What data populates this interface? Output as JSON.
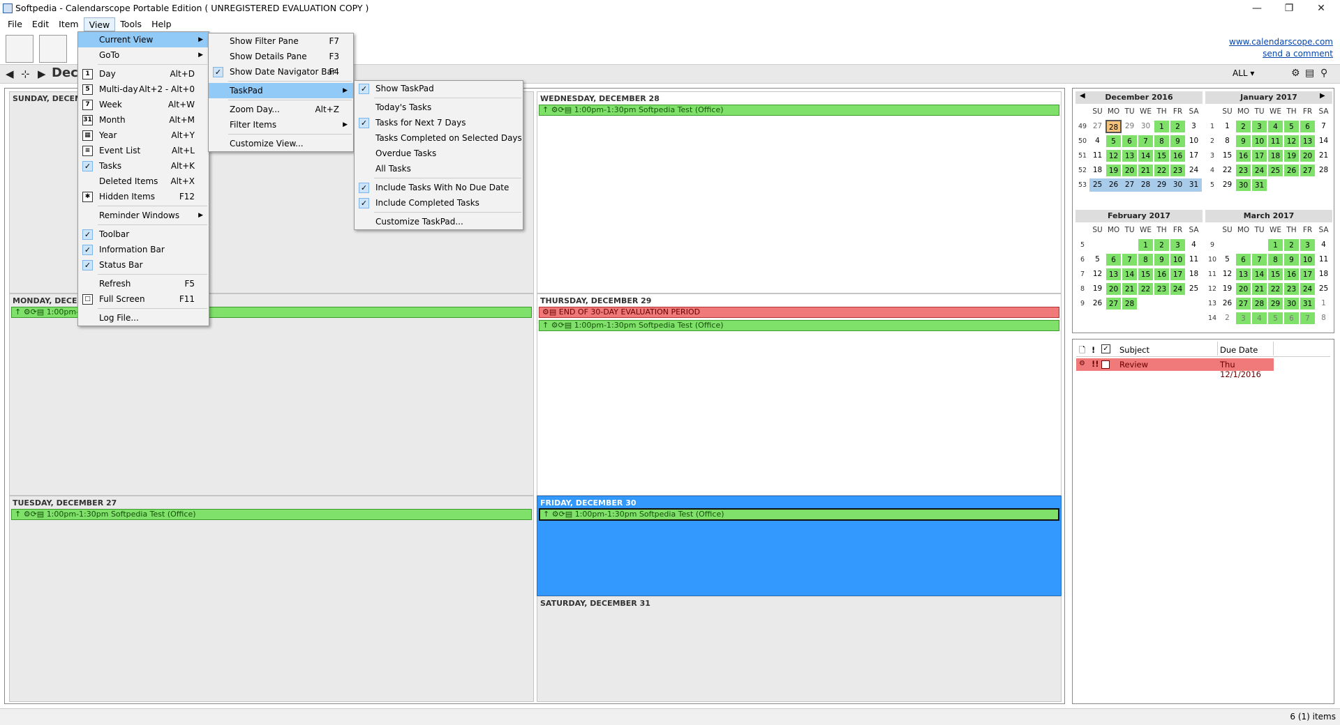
{
  "window": {
    "title": "Softpedia - Calendarscope Portable Edition ( UNREGISTERED EVALUATION COPY )"
  },
  "menubar": [
    "File",
    "Edit",
    "Item",
    "View",
    "Tools",
    "Help"
  ],
  "links": {
    "site": "www.calendarscope.com",
    "comment": "send a comment"
  },
  "nav": {
    "title": "Dec",
    "filter": "ALL"
  },
  "days": [
    {
      "header": "SUNDAY, DECEMBER 25",
      "events": []
    },
    {
      "header": "MONDAY, DECEMBER 26",
      "events": [
        "1:00pm-1:30pm Softpedia Test (Office)"
      ]
    },
    {
      "header": "TUESDAY, DECEMBER 27",
      "events": [
        "1:00pm-1:30pm Softpedia Test (Office)"
      ]
    },
    {
      "header": "WEDNESDAY, DECEMBER 28",
      "events": [
        "1:00pm-1:30pm Softpedia Test (Office)"
      ]
    },
    {
      "header": "THURSDAY, DECEMBER 29",
      "events": [
        "END OF 30-DAY EVALUATION PERIOD",
        "1:00pm-1:30pm Softpedia Test (Office)"
      ]
    },
    {
      "header": "FRIDAY, DECEMBER 30",
      "events": [
        "1:00pm-1:30pm Softpedia Test (Office)"
      ]
    },
    {
      "header": "SATURDAY, DECEMBER 31",
      "events": []
    }
  ],
  "dow": [
    "SU",
    "MO",
    "TU",
    "WE",
    "TH",
    "FR",
    "SA"
  ],
  "minicals": [
    {
      "title": "December 2016",
      "weeks": [
        {
          "n": "49",
          "d": [
            "27",
            "28",
            "29",
            "30",
            "1",
            "2",
            "3"
          ]
        },
        {
          "n": "50",
          "d": [
            "4",
            "5",
            "6",
            "7",
            "8",
            "9",
            "10"
          ]
        },
        {
          "n": "51",
          "d": [
            "11",
            "12",
            "13",
            "14",
            "15",
            "16",
            "17"
          ]
        },
        {
          "n": "52",
          "d": [
            "18",
            "19",
            "20",
            "21",
            "22",
            "23",
            "24"
          ]
        },
        {
          "n": "53",
          "d": [
            "25",
            "26",
            "27",
            "28",
            "29",
            "30",
            "31"
          ]
        }
      ]
    },
    {
      "title": "January 2017",
      "weeks": [
        {
          "n": "1",
          "d": [
            "1",
            "2",
            "3",
            "4",
            "5",
            "6",
            "7"
          ]
        },
        {
          "n": "2",
          "d": [
            "8",
            "9",
            "10",
            "11",
            "12",
            "13",
            "14"
          ]
        },
        {
          "n": "3",
          "d": [
            "15",
            "16",
            "17",
            "18",
            "19",
            "20",
            "21"
          ]
        },
        {
          "n": "4",
          "d": [
            "22",
            "23",
            "24",
            "25",
            "26",
            "27",
            "28"
          ]
        },
        {
          "n": "5",
          "d": [
            "29",
            "30",
            "31",
            "",
            "",
            "",
            ""
          ]
        }
      ]
    },
    {
      "title": "February 2017",
      "weeks": [
        {
          "n": "5",
          "d": [
            "",
            "",
            "",
            "1",
            "2",
            "3",
            "4"
          ]
        },
        {
          "n": "6",
          "d": [
            "5",
            "6",
            "7",
            "8",
            "9",
            "10",
            "11"
          ]
        },
        {
          "n": "7",
          "d": [
            "12",
            "13",
            "14",
            "15",
            "16",
            "17",
            "18"
          ]
        },
        {
          "n": "8",
          "d": [
            "19",
            "20",
            "21",
            "22",
            "23",
            "24",
            "25"
          ]
        },
        {
          "n": "9",
          "d": [
            "26",
            "27",
            "28",
            "",
            "",
            "",
            ""
          ]
        }
      ]
    },
    {
      "title": "March 2017",
      "weeks": [
        {
          "n": "9",
          "d": [
            "",
            "",
            "",
            "1",
            "2",
            "3",
            "4"
          ]
        },
        {
          "n": "10",
          "d": [
            "5",
            "6",
            "7",
            "8",
            "9",
            "10",
            "11"
          ]
        },
        {
          "n": "11",
          "d": [
            "12",
            "13",
            "14",
            "15",
            "16",
            "17",
            "18"
          ]
        },
        {
          "n": "12",
          "d": [
            "19",
            "20",
            "21",
            "22",
            "23",
            "24",
            "25"
          ]
        },
        {
          "n": "13",
          "d": [
            "26",
            "27",
            "28",
            "29",
            "30",
            "31",
            "1"
          ]
        },
        {
          "n": "14",
          "d": [
            "2",
            "3",
            "4",
            "5",
            "6",
            "7",
            "8"
          ]
        }
      ]
    }
  ],
  "tasks": {
    "columns": [
      "Subject",
      "Due Date"
    ],
    "rows": [
      {
        "subject": "Review",
        "due": "Thu 12/1/2016"
      }
    ]
  },
  "status": "6 (1) items",
  "view_menu": [
    {
      "label": "Current View",
      "arrow": true,
      "hl": true
    },
    {
      "label": "GoTo",
      "arrow": true,
      "sep": true
    },
    {
      "label": "Day",
      "sc": "Alt+D",
      "icon": "1"
    },
    {
      "label": "Multi-day",
      "sc": "Alt+2 - Alt+0",
      "icon": "5"
    },
    {
      "label": "Week",
      "sc": "Alt+W",
      "icon": "7"
    },
    {
      "label": "Month",
      "sc": "Alt+M",
      "icon": "31"
    },
    {
      "label": "Year",
      "sc": "Alt+Y",
      "icon": "▦"
    },
    {
      "label": "Event List",
      "sc": "Alt+L",
      "icon": "≡"
    },
    {
      "label": "Tasks",
      "sc": "Alt+K",
      "check": true
    },
    {
      "label": "Deleted Items",
      "sc": "Alt+X"
    },
    {
      "label": "Hidden Items",
      "sc": "F12",
      "icon": "✱",
      "sep": true
    },
    {
      "label": "Reminder Windows",
      "arrow": true,
      "sep": true
    },
    {
      "label": "Toolbar",
      "check": true
    },
    {
      "label": "Information Bar",
      "check": true
    },
    {
      "label": "Status Bar",
      "check": true,
      "sep": true
    },
    {
      "label": "Refresh",
      "sc": "F5"
    },
    {
      "label": "Full Screen",
      "sc": "F11",
      "icon": "□",
      "sep": true
    },
    {
      "label": "Log File..."
    }
  ],
  "current_view_menu": [
    {
      "label": "Show Filter Pane",
      "sc": "F7"
    },
    {
      "label": "Show Details Pane",
      "sc": "F3"
    },
    {
      "label": "Show Date Navigator Bar",
      "sc": "F4",
      "check": true,
      "sep": true
    },
    {
      "label": "TaskPad",
      "arrow": true,
      "hl": true,
      "sep": true
    },
    {
      "label": "Zoom Day...",
      "sc": "Alt+Z"
    },
    {
      "label": "Filter Items",
      "arrow": true,
      "sep": true
    },
    {
      "label": "Customize View..."
    }
  ],
  "taskpad_menu": [
    {
      "label": "Show TaskPad",
      "check": true,
      "sep": true
    },
    {
      "label": "Today's Tasks"
    },
    {
      "label": "Tasks for Next 7 Days",
      "check": true
    },
    {
      "label": "Tasks Completed on Selected Days"
    },
    {
      "label": "Overdue Tasks"
    },
    {
      "label": "All Tasks",
      "sep": true
    },
    {
      "label": "Include Tasks With No Due Date",
      "check": true
    },
    {
      "label": "Include Completed Tasks",
      "check": true,
      "sep": true
    },
    {
      "label": "Customize TaskPad..."
    }
  ]
}
